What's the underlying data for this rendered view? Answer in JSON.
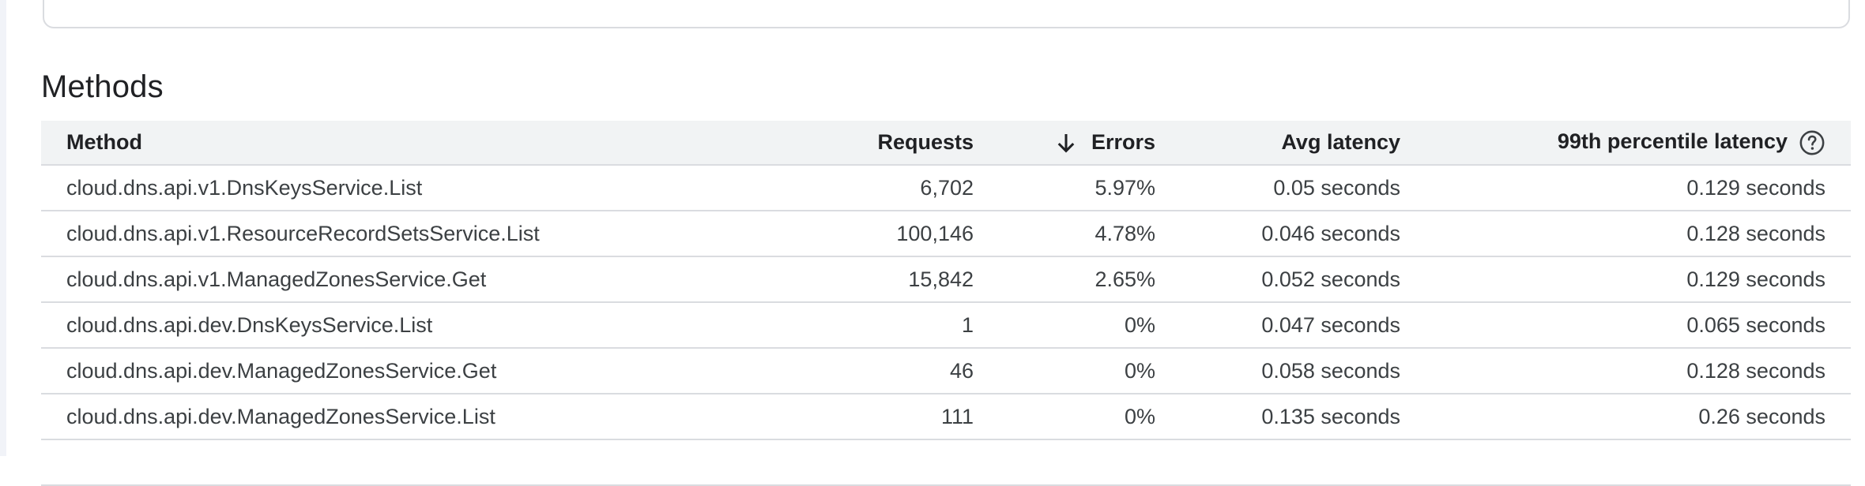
{
  "section": {
    "title": "Methods"
  },
  "table": {
    "headers": {
      "method": "Method",
      "requests": "Requests",
      "errors": "Errors",
      "avg_latency": "Avg latency",
      "p99_latency": "99th percentile latency"
    },
    "sorted_by": "errors",
    "sort_direction": "descending",
    "rows": [
      {
        "method": "cloud.dns.api.v1.DnsKeysService.List",
        "requests": "6,702",
        "errors": "5.97%",
        "avg_latency": "0.05 seconds",
        "p99_latency": "0.129 seconds"
      },
      {
        "method": "cloud.dns.api.v1.ResourceRecordSetsService.List",
        "requests": "100,146",
        "errors": "4.78%",
        "avg_latency": "0.046 seconds",
        "p99_latency": "0.128 seconds"
      },
      {
        "method": "cloud.dns.api.v1.ManagedZonesService.Get",
        "requests": "15,842",
        "errors": "2.65%",
        "avg_latency": "0.052 seconds",
        "p99_latency": "0.129 seconds"
      },
      {
        "method": "cloud.dns.api.dev.DnsKeysService.List",
        "requests": "1",
        "errors": "0%",
        "avg_latency": "0.047 seconds",
        "p99_latency": "0.065 seconds"
      },
      {
        "method": "cloud.dns.api.dev.ManagedZonesService.Get",
        "requests": "46",
        "errors": "0%",
        "avg_latency": "0.058 seconds",
        "p99_latency": "0.128 seconds"
      },
      {
        "method": "cloud.dns.api.dev.ManagedZonesService.List",
        "requests": "111",
        "errors": "0%",
        "avg_latency": "0.135 seconds",
        "p99_latency": "0.26 seconds"
      }
    ]
  },
  "icons": {
    "sort": "arrow-down-icon",
    "help": "help-circle-icon"
  },
  "colors": {
    "header_bg": "#f1f3f4",
    "border": "#dadce0",
    "text": "#202124",
    "cell_text": "#3c4043"
  }
}
